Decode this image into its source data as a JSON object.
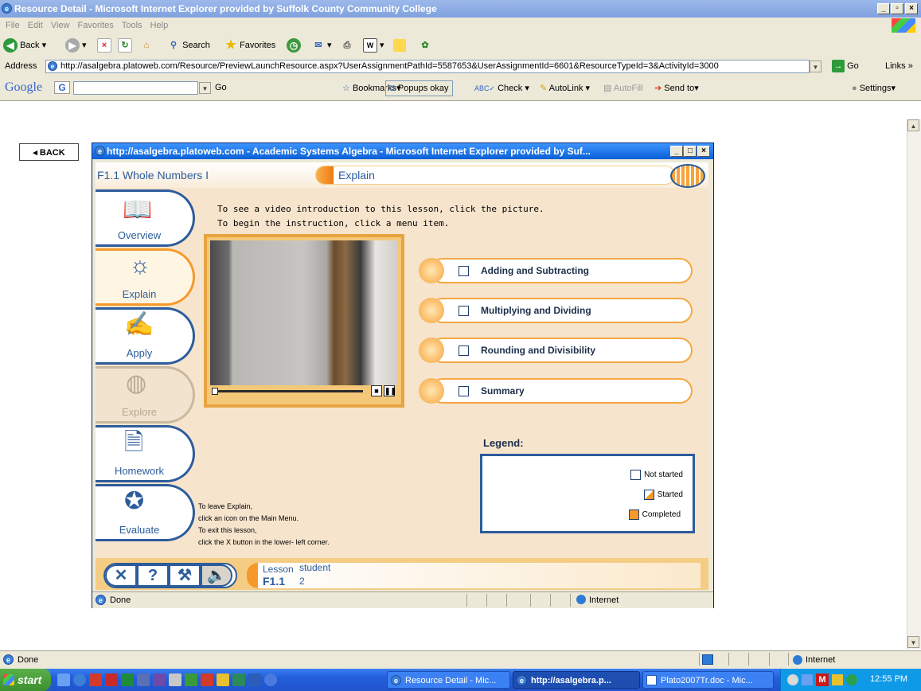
{
  "window": {
    "title": "Resource Detail - Microsoft Internet Explorer provided by Suffolk County Community College"
  },
  "menu": [
    "File",
    "Edit",
    "View",
    "Favorites",
    "Tools",
    "Help"
  ],
  "toolbar": {
    "back": "Back",
    "search": "Search",
    "favorites": "Favorites"
  },
  "address": {
    "label": "Address",
    "url": "http://asalgebra.platoweb.com/Resource/PreviewLaunchResource.aspx?UserAssignmentPathId=5587653&UserAssignmentId=6601&ResourceTypeId=3&ActivityId=3000",
    "go": "Go",
    "links": "Links"
  },
  "googlebar": {
    "logo": "Google",
    "go": "Go",
    "bookmarks": "Bookmarks",
    "popups": "Popups okay",
    "check": "Check",
    "autolink": "AutoLink",
    "autofill": "AutoFill",
    "sendto": "Send to",
    "settings": "Settings"
  },
  "page": {
    "back": "BACK"
  },
  "popup": {
    "title": "http://asalgebra.platoweb.com - Academic Systems Algebra - Microsoft Internet Explorer provided by Suf...",
    "lesson_title": "F1.1 Whole Numbers I",
    "section": "Explain",
    "nav": [
      "Overview",
      "Explain",
      "Apply",
      "Explore",
      "Homework",
      "Evaluate"
    ],
    "intro_line1": "To see a video introduction to this lesson, click the picture.",
    "intro_line2": "To begin the instruction, click a menu item.",
    "menu_items": [
      "Adding and Subtracting",
      "Multiplying and Dividing",
      "Rounding and Divisibility",
      "Summary"
    ],
    "legend": {
      "title": "Legend:",
      "not_started": "Not started",
      "started": "Started",
      "completed": "Completed"
    },
    "help_lines": [
      "To leave Explain,",
      "click an icon on the Main Menu.",
      "To exit this lesson,",
      "click the X button in the lower- left corner."
    ],
    "lesson_label": "Lesson",
    "lesson_code": "F1.1",
    "student_label": "student",
    "student_num": "2",
    "status_done": "Done",
    "status_zone": "Internet"
  },
  "status": {
    "done": "Done",
    "zone": "Internet"
  },
  "taskbar": {
    "start": "start",
    "tasks": [
      "Resource Detail - Mic...",
      "http://asalgebra.p...",
      "Plato2007Tr.doc - Mic..."
    ],
    "time": "12:55 PM"
  },
  "colors": {
    "accent": "#2c5c9c",
    "orange": "#f5a742",
    "panel": "#f7e4cc"
  }
}
